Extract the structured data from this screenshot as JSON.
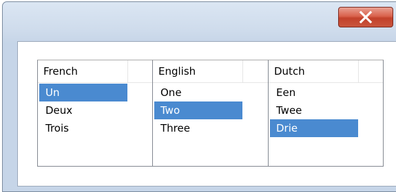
{
  "window": {
    "close_icon": "close-x-icon"
  },
  "columns": [
    {
      "header": "French",
      "items": [
        "Un",
        "Deux",
        "Trois"
      ],
      "selected_index": 0
    },
    {
      "header": "English",
      "items": [
        "One",
        "Two",
        "Three"
      ],
      "selected_index": 1
    },
    {
      "header": "Dutch",
      "items": [
        "Een",
        "Twee",
        "Drie"
      ],
      "selected_index": 2
    }
  ],
  "colors": {
    "selection": "#4a8ad0",
    "close_button": "#d9624c"
  }
}
